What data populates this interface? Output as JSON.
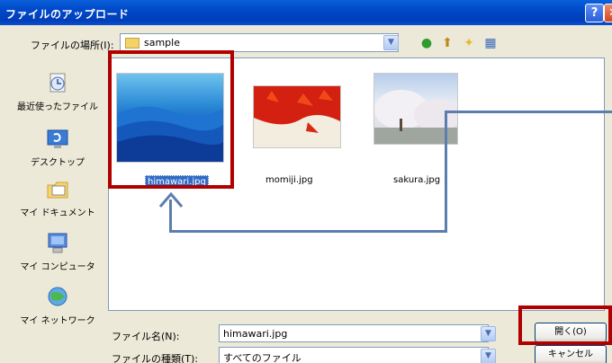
{
  "window": {
    "title": "ファイルのアップロード",
    "help": "?",
    "close": "✕"
  },
  "lookin": {
    "label": "ファイルの場所(I):",
    "value": "sample"
  },
  "places": [
    {
      "label": "最近使ったファイル"
    },
    {
      "label": "デスクトップ"
    },
    {
      "label": "マイ ドキュメント"
    },
    {
      "label": "マイ コンピュータ"
    },
    {
      "label": "マイ ネットワーク"
    }
  ],
  "files": [
    {
      "name": "himawari.jpg",
      "selected": true
    },
    {
      "name": "momiji.jpg",
      "selected": false
    },
    {
      "name": "sakura.jpg",
      "selected": false
    }
  ],
  "filename": {
    "label": "ファイル名(N):",
    "value": "himawari.jpg"
  },
  "filetype": {
    "label": "ファイルの種類(T):",
    "value": "すべてのファイル"
  },
  "buttons": {
    "open": "開く(O)",
    "cancel": "キャンセル"
  },
  "colors": {
    "titlebar": "#0049C9",
    "highlight": "#B00000",
    "arrow": "#5B7DB0",
    "selection": "#316AC5"
  }
}
